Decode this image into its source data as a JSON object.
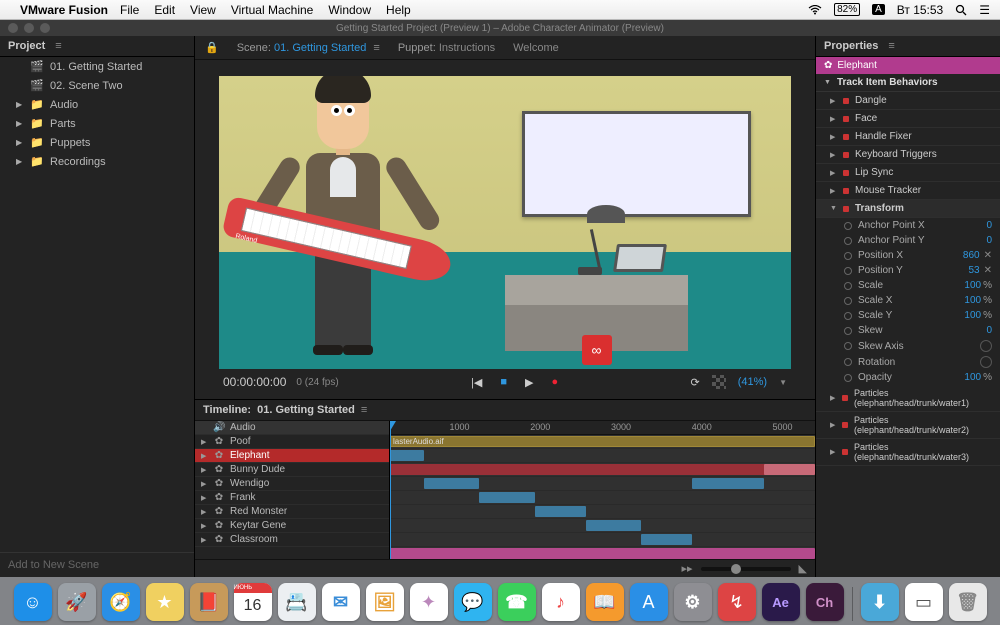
{
  "menubar": {
    "app": "VMware Fusion",
    "items": [
      "File",
      "Edit",
      "View",
      "Virtual Machine",
      "Window",
      "Help"
    ],
    "clock": "Вт 15:53",
    "battery": "82%"
  },
  "window_title": "Getting Started Project (Preview 1) – Adobe Character Animator (Preview)",
  "project": {
    "title": "Project",
    "items": [
      {
        "icon": "scene",
        "label": "01. Getting Started",
        "expandable": false
      },
      {
        "icon": "scene",
        "label": "02. Scene Two",
        "expandable": false
      },
      {
        "icon": "folder",
        "label": "Audio",
        "expandable": true
      },
      {
        "icon": "folder",
        "label": "Parts",
        "expandable": true
      },
      {
        "icon": "folder",
        "label": "Puppets",
        "expandable": true
      },
      {
        "icon": "folder",
        "label": "Recordings",
        "expandable": true
      }
    ],
    "add_label": "Add to New Scene"
  },
  "scene_tabs": {
    "scene_prefix": "Scene:",
    "scene_name": "01. Getting Started",
    "puppet_prefix": "Puppet:",
    "puppet_name": "Instructions",
    "welcome": "Welcome"
  },
  "keytar_brand": "Roland",
  "cc_symbol": "∞",
  "transport": {
    "timecode": "00:00:00:00",
    "fps": "0 (24 fps)",
    "zoom": "(41%)"
  },
  "timeline": {
    "title_prefix": "Timeline:",
    "title": "01. Getting Started",
    "ruler": [
      "1000",
      "2000",
      "3000",
      "4000",
      "5000"
    ],
    "audio_clip": "lasterAudio.aif",
    "tracks": [
      {
        "label": "Audio",
        "icon": "speaker",
        "audio": true
      },
      {
        "label": "Poof",
        "icon": "puppet"
      },
      {
        "label": "Elephant",
        "icon": "puppet",
        "selected": true
      },
      {
        "label": "Bunny Dude",
        "icon": "puppet"
      },
      {
        "label": "Wendigo",
        "icon": "puppet"
      },
      {
        "label": "Frank",
        "icon": "puppet"
      },
      {
        "label": "Red Monster",
        "icon": "puppet"
      },
      {
        "label": "Keytar Gene",
        "icon": "puppet"
      },
      {
        "label": "Classroom",
        "icon": "puppet"
      }
    ]
  },
  "properties": {
    "title": "Properties",
    "crumb": "Elephant",
    "behaviors_hdr": "Track Item Behaviors",
    "behaviors": [
      "Dangle",
      "Face",
      "Handle Fixer",
      "Keyboard Triggers",
      "Lip Sync",
      "Mouse Tracker"
    ],
    "transform_hdr": "Transform",
    "transform": [
      {
        "name": "Anchor Point X",
        "val": "0",
        "unit": ""
      },
      {
        "name": "Anchor Point Y",
        "val": "0",
        "unit": ""
      },
      {
        "name": "Position X",
        "val": "860",
        "unit": "",
        "x": true
      },
      {
        "name": "Position Y",
        "val": "53",
        "unit": "",
        "x": true
      },
      {
        "name": "Scale",
        "val": "100",
        "unit": "%"
      },
      {
        "name": "Scale X",
        "val": "100",
        "unit": "%"
      },
      {
        "name": "Scale Y",
        "val": "100",
        "unit": "%"
      },
      {
        "name": "Skew",
        "val": "0",
        "unit": ""
      },
      {
        "name": "Skew Axis",
        "val": "",
        "unit": "",
        "clock": true
      },
      {
        "name": "Rotation",
        "val": "",
        "unit": "",
        "clock": true
      },
      {
        "name": "Opacity",
        "val": "100",
        "unit": "%"
      }
    ],
    "particles": [
      "Particles (elephant/head/trunk/water1)",
      "Particles (elephant/head/trunk/water2)",
      "Particles (elephant/head/trunk/water3)"
    ]
  },
  "dock": [
    {
      "bg": "#1e8fe8",
      "txt": "☺"
    },
    {
      "bg": "#9aa0a6",
      "txt": "🚀"
    },
    {
      "bg": "#2a8fe6",
      "txt": "🧭"
    },
    {
      "bg": "#f0d060",
      "txt": "★"
    },
    {
      "bg": "#c79a5a",
      "txt": "📕"
    },
    {
      "bg": "#ffffff",
      "txt": "16",
      "fg": "#d33"
    },
    {
      "bg": "#eceff2",
      "txt": "📇",
      "fg": "#555"
    },
    {
      "bg": "#ffffff",
      "txt": "✉︎",
      "fg": "#3b8ed8"
    },
    {
      "bg": "#ffffff",
      "txt": "🖼",
      "fg": "#e8a23a"
    },
    {
      "bg": "#ffffff",
      "txt": "✦",
      "fg": "#b8b"
    },
    {
      "bg": "#2fb4f0",
      "txt": "💬"
    },
    {
      "bg": "#3bcf5c",
      "txt": "☎︎"
    },
    {
      "bg": "#ffffff",
      "txt": "♪",
      "fg": "#e44"
    },
    {
      "bg": "#f59a2d",
      "txt": "📖"
    },
    {
      "bg": "#2a8fe6",
      "txt": "A"
    },
    {
      "bg": "#8e8e93",
      "txt": "⚙︎"
    },
    {
      "bg": "#d44",
      "txt": "↯"
    },
    {
      "bg": "#2a1a4a",
      "txt": "Ae",
      "fg": "#b89aff"
    },
    {
      "bg": "#3a1a3a",
      "txt": "Ch",
      "fg": "#d090c8"
    }
  ],
  "dock_right": [
    {
      "bg": "#4aa8d8",
      "txt": "⬇︎"
    },
    {
      "bg": "#ffffff",
      "txt": "▭",
      "fg": "#555"
    },
    {
      "bg": "#e8e8e8",
      "txt": "🗑",
      "fg": "#888"
    }
  ],
  "calendar_month": "ИЮНЬ"
}
